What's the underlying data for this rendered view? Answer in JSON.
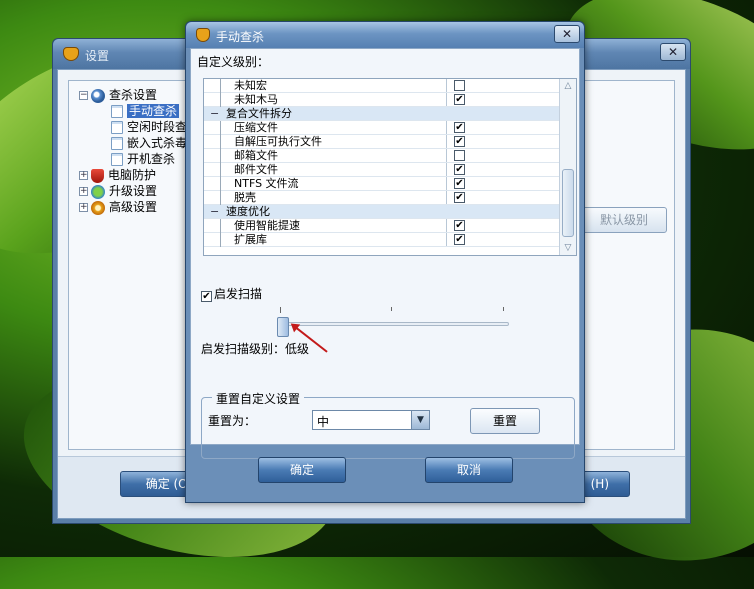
{
  "background_window": {
    "title": "设置",
    "close_label": "✕",
    "tree": [
      {
        "label": "查杀设置",
        "icon": "magnifier-icon",
        "expanded": true
      },
      {
        "label": "手动查杀",
        "icon": "document-icon",
        "selected": true
      },
      {
        "label": "空闲时段查",
        "icon": "document-icon"
      },
      {
        "label": "嵌入式杀毒",
        "icon": "document-icon"
      },
      {
        "label": "开机查杀",
        "icon": "document-icon"
      },
      {
        "label": "电脑防护",
        "icon": "shield-icon"
      },
      {
        "label": "升级设置",
        "icon": "update-icon"
      },
      {
        "label": "高级设置",
        "icon": "gear-icon"
      }
    ],
    "side_button": "默认级别",
    "ok_button": "确定 (O)",
    "right_button": "(H)"
  },
  "dialog": {
    "title": "手动查杀",
    "close_label": "✕",
    "custom_level_label": "自定义级别：",
    "items": [
      {
        "type": "item",
        "name": "未知宏",
        "checked": false
      },
      {
        "type": "item",
        "name": "未知木马",
        "checked": true
      },
      {
        "type": "group",
        "name": "复合文件拆分",
        "toggle": "−"
      },
      {
        "type": "item",
        "name": "压缩文件",
        "checked": true
      },
      {
        "type": "item",
        "name": "自解压可执行文件",
        "checked": true
      },
      {
        "type": "item",
        "name": "邮箱文件",
        "checked": false
      },
      {
        "type": "item",
        "name": "邮件文件",
        "checked": true
      },
      {
        "type": "item",
        "name": "NTFS 文件流",
        "checked": true
      },
      {
        "type": "item",
        "name": "脱壳",
        "checked": true
      },
      {
        "type": "group",
        "name": "速度优化",
        "toggle": "−"
      },
      {
        "type": "item",
        "name": "使用智能提速",
        "checked": true
      },
      {
        "type": "item",
        "name": "扩展库",
        "checked": true
      }
    ],
    "heuristic_scan": {
      "label": "启发扫描",
      "checked": true
    },
    "slider": {
      "value_fraction": 0.0,
      "ticks": 4
    },
    "heuristic_level_label": "启发扫描级别：低级",
    "reset_group": {
      "legend": "重置自定义设置",
      "reset_to_label": "重置为：",
      "selected": "中",
      "reset_button": "重置"
    },
    "ok_button": "确定",
    "cancel_button": "取消"
  },
  "colors": {
    "selection": "#3a6fc4",
    "accent_red": "#c31a1a"
  }
}
